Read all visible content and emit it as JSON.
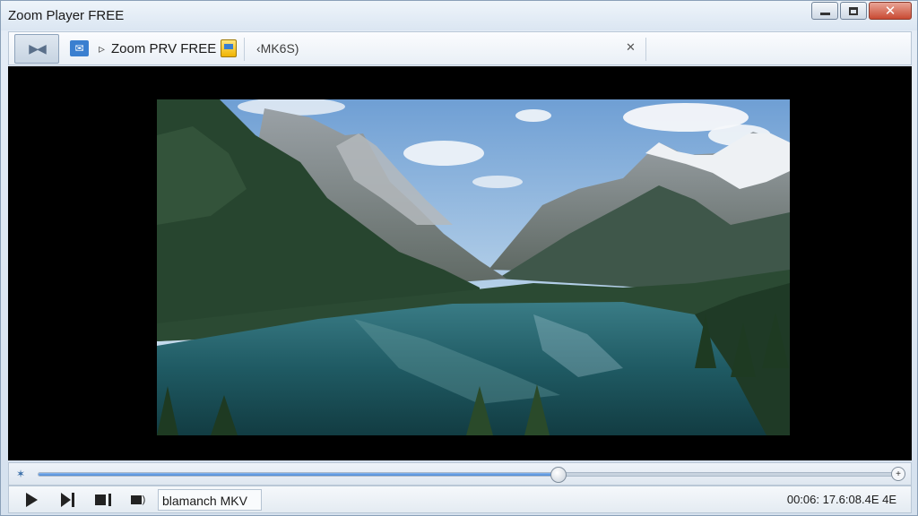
{
  "window": {
    "title": "Zoom Player FREE"
  },
  "toolbar": {
    "product_name": "Zoom PRV FREE",
    "format_label": "‹MK6S)"
  },
  "video": {
    "content": "mountain-lake-landscape"
  },
  "seekbar": {
    "progress_percent": 60.8
  },
  "controls": {
    "file_name": "blamanch MKV",
    "time_display": "00:06: 17.6:08.4E 4E"
  },
  "colors": {
    "accent": "#4a88d6",
    "close_button": "#c94a33",
    "video_background": "#000000"
  }
}
